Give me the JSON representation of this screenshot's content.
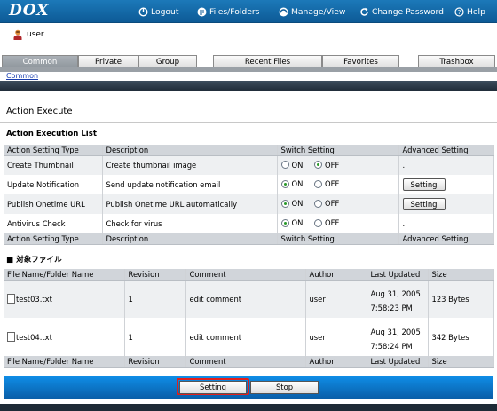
{
  "app": {
    "logo": "DOX"
  },
  "topnav": [
    {
      "label": "Logout",
      "icon": "logout-icon"
    },
    {
      "label": "Files/Folders",
      "icon": "files-icon"
    },
    {
      "label": "Manage/View",
      "icon": "manage-icon"
    },
    {
      "label": "Change Password",
      "icon": "refresh-icon"
    },
    {
      "label": "Help",
      "icon": "help-icon"
    }
  ],
  "user": {
    "name": "user",
    "icon": "user-icon"
  },
  "tabs": [
    {
      "label": "Common",
      "active": true
    },
    {
      "label": "Private",
      "active": false
    },
    {
      "label": "Group",
      "active": false
    },
    {
      "label": "Recent Files",
      "active": false
    },
    {
      "label": "Favorites",
      "active": false
    },
    {
      "label": "Trashbox",
      "active": false
    }
  ],
  "breadcrumb": "Common",
  "page": {
    "title": "Action Execute"
  },
  "actions": {
    "section_title": "Action Execution List",
    "headers": [
      "Action Setting Type",
      "Description",
      "Switch Setting",
      "Advanced Setting"
    ],
    "on_label": "ON",
    "off_label": "OFF",
    "rows": [
      {
        "type": "Create Thumbnail",
        "description": "Create thumbnail image",
        "switch": "off",
        "advanced": "."
      },
      {
        "type": "Update Notification",
        "description": "Send update notification email",
        "switch": "on",
        "advanced": "Setting"
      },
      {
        "type": "Publish Onetime URL",
        "description": "Publish Onetime URL automatically",
        "switch": "on",
        "advanced": "Setting"
      },
      {
        "type": "Antivirus Check",
        "description": "Check for virus",
        "switch": "on",
        "advanced": "."
      }
    ]
  },
  "files": {
    "section_title": "■ 対象ファイル",
    "headers": [
      "File Name/Folder Name",
      "Revision",
      "Comment",
      "Author",
      "Last Updated",
      "Size"
    ],
    "rows": [
      {
        "name": "test03.txt",
        "revision": "1",
        "comment": "edit comment",
        "author": "user",
        "date": "Aug 31, 2005",
        "time": "7:58:23 PM",
        "size": "123 Bytes"
      },
      {
        "name": "test04.txt",
        "revision": "1",
        "comment": "edit comment",
        "author": "user",
        "date": "Aug 31, 2005",
        "time": "7:58:24 PM",
        "size": "342 Bytes"
      }
    ]
  },
  "footer_buttons": {
    "setting": "Setting",
    "stop": "Stop"
  },
  "colors": {
    "header_blue": "#1a6fb0",
    "action_bar": "#0f8de6",
    "highlight": "#e0201c",
    "radio_on": "#2a9a2a"
  }
}
